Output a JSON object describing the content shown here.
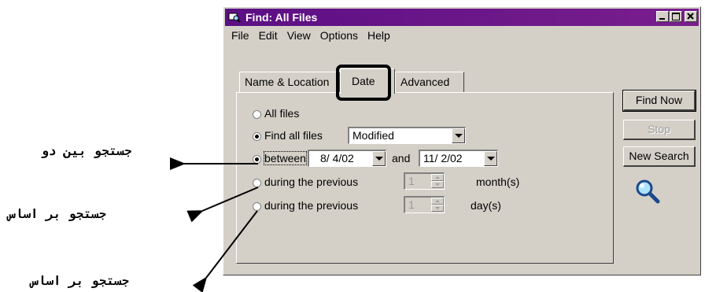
{
  "window": {
    "title": "Find: All Files",
    "title_color": "#5b0f84"
  },
  "menubar": {
    "items": [
      "File",
      "Edit",
      "View",
      "Options",
      "Help"
    ]
  },
  "tabs": [
    {
      "label": "Name & Location"
    },
    {
      "label": "Date",
      "active": true
    },
    {
      "label": "Advanced"
    }
  ],
  "date_panel": {
    "all_files_label": "All files",
    "find_all_files_label": "Find all files",
    "find_all_files_value": "Modified",
    "between_label": "between",
    "between_from": "8/ 4/02",
    "and_label": "and",
    "between_to": "11/ 2/02",
    "months_prefix": "during the previous",
    "months_value": "1",
    "months_unit": "month(s)",
    "days_prefix": "during the previous",
    "days_value": "1",
    "days_unit": "day(s)"
  },
  "buttons": {
    "find_now": "Find Now",
    "stop": "Stop",
    "new_search": "New Search"
  },
  "annotations": {
    "between": "جستجو بين دو",
    "months": "جستجو بر اساس",
    "days": "جستجو بر اساس"
  },
  "icons": {
    "window": "find-icon",
    "search": "magnifier-icon"
  }
}
